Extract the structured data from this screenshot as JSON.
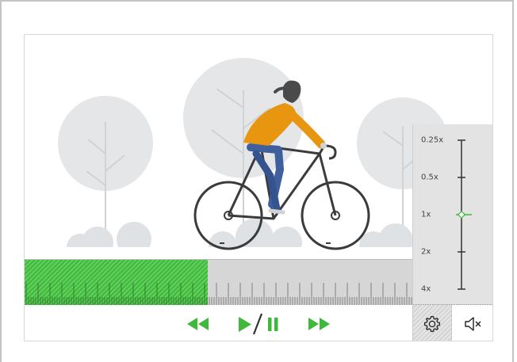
{
  "player": {
    "progress_fraction": 0.39,
    "accent_color": "#3fb83b",
    "speed_options": [
      "0.25x",
      "0.5x",
      "1x",
      "2x",
      "4x"
    ],
    "current_speed": "1x",
    "controls": {
      "rewind_icon": "rewind-icon",
      "play_icon": "play-icon",
      "pause_icon": "pause-icon",
      "fast_forward_icon": "fast-forward-icon",
      "settings_icon": "gear-icon",
      "mute_icon": "volume-muted-icon"
    }
  }
}
